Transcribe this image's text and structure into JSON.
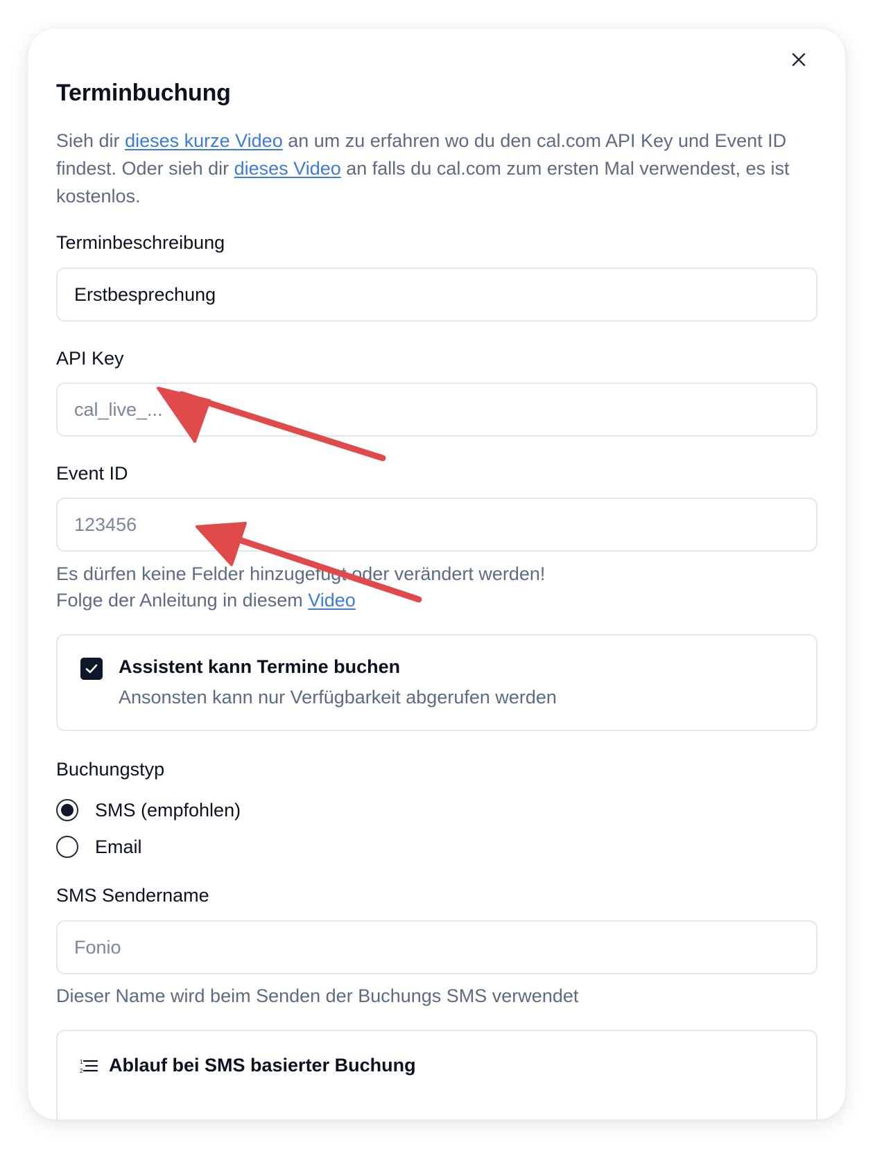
{
  "dialog": {
    "title": "Terminbuchung",
    "intro": {
      "part1": "Sieh dir ",
      "link1": "dieses kurze Video",
      "part2": " an um zu erfahren wo du den cal.com API Key und Event ID findest. Oder sieh dir ",
      "link2": "dieses Video",
      "part3": " an falls du cal.com zum ersten Mal verwendest, es ist kostenlos."
    },
    "close_icon": "close-icon"
  },
  "fields": {
    "description": {
      "label": "Terminbeschreibung",
      "value": "Erstbesprechung",
      "placeholder": ""
    },
    "api_key": {
      "label": "API Key",
      "value": "",
      "placeholder": "cal_live_..."
    },
    "event_id": {
      "label": "Event ID",
      "value": "",
      "placeholder": "123456"
    }
  },
  "warning": {
    "line1": "Es dürfen keine Felder hinzugefügt oder verändert werden!",
    "line2_text": "Folge der Anleitung in diesem ",
    "line2_link": "Video"
  },
  "booking_option": {
    "checked": true,
    "title": "Assistent kann Termine buchen",
    "subtitle": "Ansonsten kann nur Verfügbarkeit abgerufen werden"
  },
  "booking_type": {
    "label": "Buchungstyp",
    "options": [
      {
        "label": "SMS (empfohlen)",
        "selected": true
      },
      {
        "label": "Email",
        "selected": false
      }
    ]
  },
  "sms_sender": {
    "label": "SMS Sendername",
    "value": "",
    "placeholder": "Fonio",
    "hint": "Dieser Name wird beim Senden der Buchungs SMS verwendet"
  },
  "sms_flow_section": {
    "icon": "list-icon",
    "title": "Ablauf bei SMS basierter Buchung"
  },
  "annotation": {
    "arrow_color": "#e04a4a"
  },
  "colors": {
    "text_primary": "#0b1220",
    "text_secondary": "#5b6b84",
    "link": "#3b7bd9",
    "border": "#e3e7ec",
    "checkbox": "#0f172a"
  }
}
